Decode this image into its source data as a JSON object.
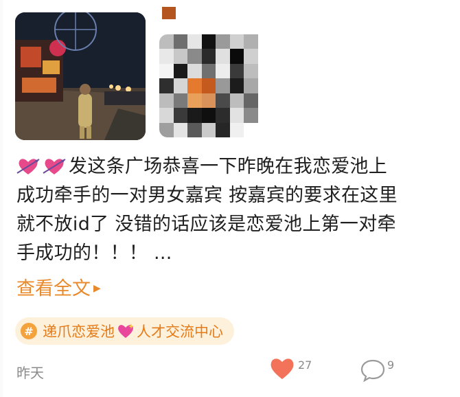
{
  "post": {
    "text_lines": [
      "发这条广场恭喜一下昨晚在我恋爱池上",
      "成功牵手的一对男女嘉宾 按嘉宾的要求在这里",
      "就不放id了 没错的话应该是恋爱池上第一对牵",
      "手成功的！！！ ..."
    ],
    "see_more": "查看全文",
    "topic": {
      "hash": "#",
      "before": "递爪恋爱池",
      "after": "人才交流中心"
    },
    "timestamp": "昨天",
    "likes": "27",
    "comments": "9"
  },
  "colors": {
    "accent": "#e88a2c",
    "like": "#f2735a",
    "topic_bg": "#fdf1dc"
  },
  "icons": {
    "heart_arrow": "cupid-heart-emoji",
    "sparkle_heart": "sparkling-heart-emoji",
    "like": "heart-icon",
    "comment": "comment-bubble-icon"
  }
}
